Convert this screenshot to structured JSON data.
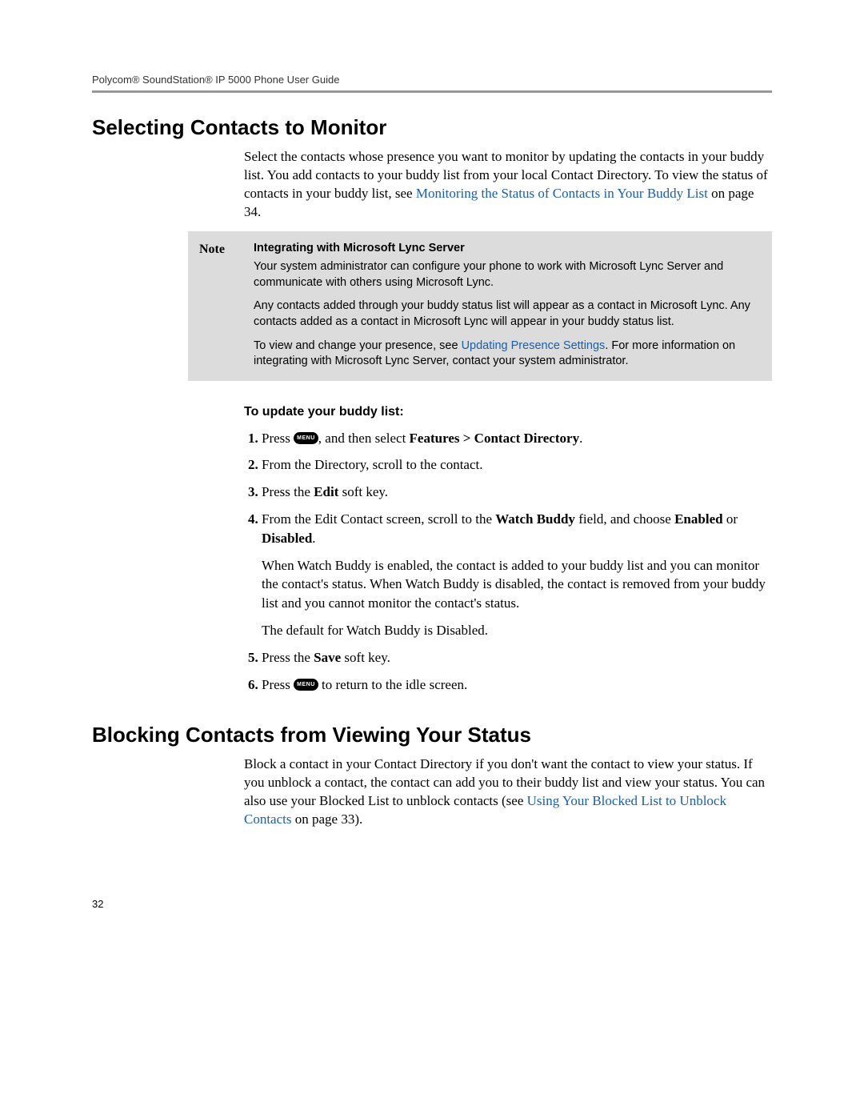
{
  "header": "Polycom® SoundStation® IP 5000 Phone User Guide",
  "section1": {
    "title": "Selecting Contacts to Monitor",
    "intro_pre": "Select the contacts whose presence you want to monitor by updating the contacts in your buddy list. You add contacts to your buddy list from your local Contact Directory. To view the status of contacts in your buddy list, see ",
    "intro_link": "Monitoring the Status of Contacts in Your Buddy List",
    "intro_post": " on page 34."
  },
  "note": {
    "label": "Note",
    "title": "Integrating with Microsoft Lync Server",
    "p1": "Your system administrator can configure your phone to work with Microsoft Lync Server and communicate with others using Microsoft Lync.",
    "p2": "Any contacts added through your buddy status list will appear as a contact in Microsoft Lync. Any contacts added as a contact in Microsoft Lync will appear in your buddy status list.",
    "p3_pre": "To view and change your presence, see ",
    "p3_link": "Updating Presence Settings",
    "p3_post": ". For more information on integrating with Microsoft Lync Server, contact your system administrator."
  },
  "procedure": {
    "title": "To update your buddy list:",
    "menu_label": "MENU",
    "step1_pre": "Press ",
    "step1_post_a": ", and then select ",
    "step1_b": "Features > Contact Directory",
    "step1_post_b": ".",
    "step2": "From the Directory, scroll to the contact.",
    "step3_a": "Press the ",
    "step3_b": "Edit",
    "step3_c": " soft key.",
    "step4_a": "From the Edit Contact screen, scroll to the ",
    "step4_b": "Watch Buddy",
    "step4_c": " field, and choose ",
    "step4_d": "Enabled",
    "step4_e": " or ",
    "step4_f": "Disabled",
    "step4_g": ".",
    "step4_extra1": "When Watch Buddy is enabled, the contact is added to your buddy list and you can monitor the contact's status. When Watch Buddy is disabled, the contact is removed from your buddy list and you cannot monitor the contact's status.",
    "step4_extra2": "The default for Watch Buddy is Disabled.",
    "step5_a": "Press the ",
    "step5_b": "Save",
    "step5_c": " soft key.",
    "step6_pre": "Press ",
    "step6_post": " to return to the idle screen."
  },
  "section2": {
    "title": "Blocking Contacts from Viewing Your Status",
    "p_pre": "Block a contact in your Contact Directory if you don't want the contact to view your status. If you unblock a contact, the contact can add you to their buddy list and view your status. You can also use your Blocked List to unblock contacts (see ",
    "p_link": "Using Your Blocked List to Unblock Contacts",
    "p_post": " on page 33)."
  },
  "page_number": "32"
}
